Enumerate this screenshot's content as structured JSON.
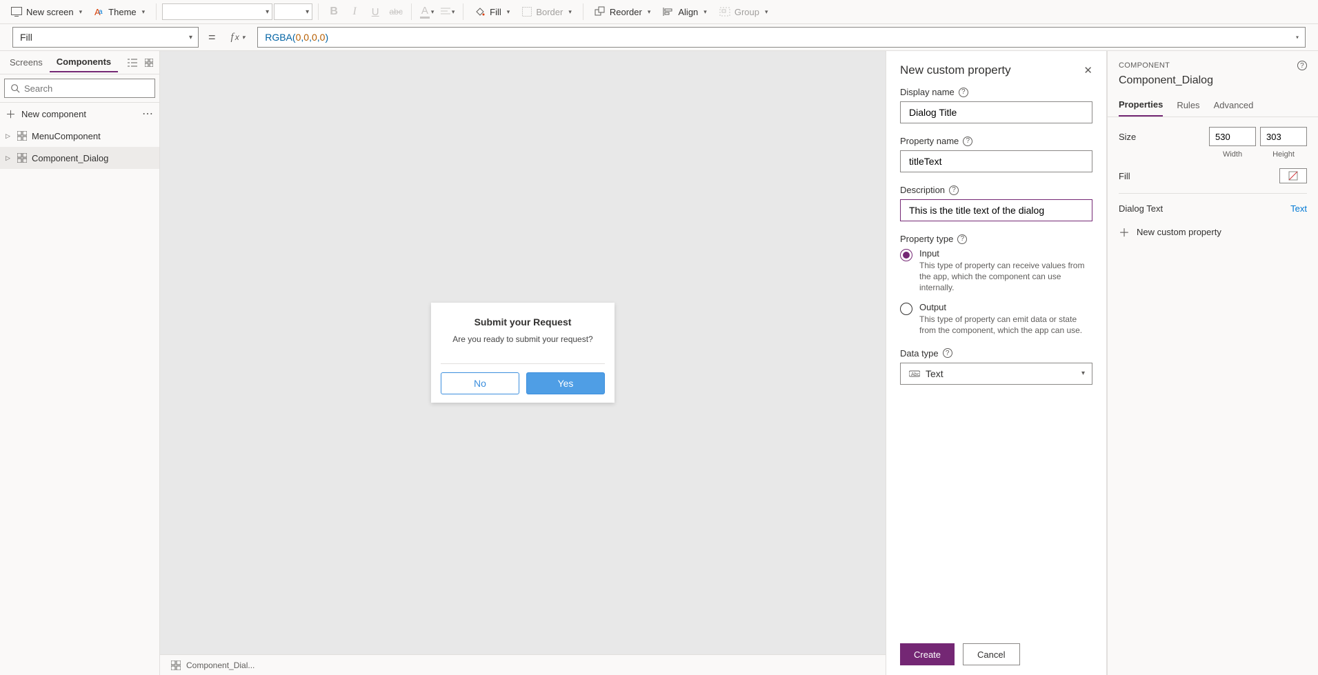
{
  "toolbar": {
    "new_screen": "New screen",
    "theme": "Theme",
    "fill": "Fill",
    "border": "Border",
    "reorder": "Reorder",
    "align": "Align",
    "group": "Group"
  },
  "formula_bar": {
    "property": "Fill",
    "fn": "RGBA",
    "args": [
      "0",
      "0",
      "0",
      "0"
    ]
  },
  "left_panel": {
    "tabs": {
      "screens": "Screens",
      "components": "Components"
    },
    "search_placeholder": "Search",
    "new_component": "New component",
    "items": [
      {
        "name": "MenuComponent"
      },
      {
        "name": "Component_Dialog"
      }
    ]
  },
  "canvas": {
    "dialog": {
      "title": "Submit your Request",
      "message": "Are you ready to submit your request?",
      "no": "No",
      "yes": "Yes"
    }
  },
  "prop_pane": {
    "title": "New custom property",
    "display_name_label": "Display name",
    "display_name": "Dialog Title",
    "property_name_label": "Property name",
    "property_name": "titleText",
    "description_label": "Description",
    "description": "This is the title text of the dialog",
    "property_type_label": "Property type",
    "input": {
      "title": "Input",
      "desc": "This type of property can receive values from the app, which the component can use internally."
    },
    "output": {
      "title": "Output",
      "desc": "This type of property can emit data or state from the component, which the app can use."
    },
    "data_type_label": "Data type",
    "data_type": "Text",
    "create": "Create",
    "cancel": "Cancel"
  },
  "right_pane": {
    "header": "COMPONENT",
    "title": "Component_Dialog",
    "tabs": {
      "properties": "Properties",
      "rules": "Rules",
      "advanced": "Advanced"
    },
    "size_label": "Size",
    "width": "530",
    "height": "303",
    "width_label": "Width",
    "height_label": "Height",
    "fill_label": "Fill",
    "dialog_text_label": "Dialog Text",
    "dialog_text_value": "Text",
    "new_custom_property": "New custom property"
  },
  "status_bar": {
    "component_name": "Component_Dial..."
  }
}
